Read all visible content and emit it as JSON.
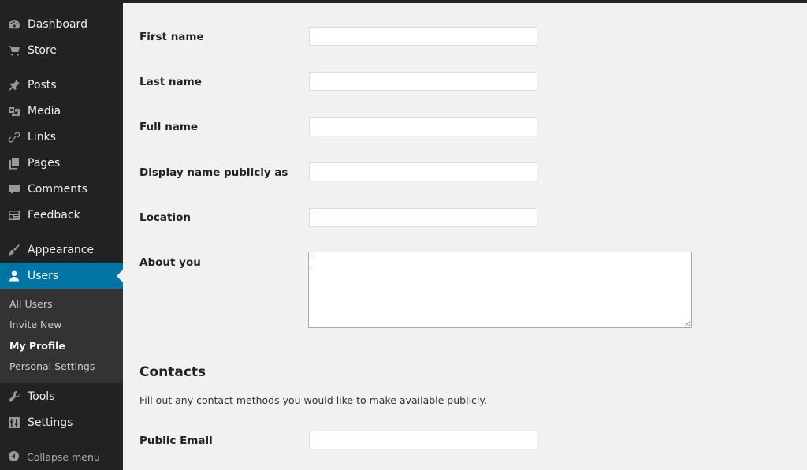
{
  "sidebar": {
    "items": [
      {
        "label": "Dashboard",
        "icon": "dashboard-icon"
      },
      {
        "label": "Store",
        "icon": "cart-icon"
      },
      {
        "label": "Posts",
        "icon": "pin-icon"
      },
      {
        "label": "Media",
        "icon": "media-icon"
      },
      {
        "label": "Links",
        "icon": "link-icon"
      },
      {
        "label": "Pages",
        "icon": "pages-icon"
      },
      {
        "label": "Comments",
        "icon": "comment-icon"
      },
      {
        "label": "Feedback",
        "icon": "feedback-icon"
      },
      {
        "label": "Appearance",
        "icon": "brush-icon"
      },
      {
        "label": "Users",
        "icon": "user-icon"
      },
      {
        "label": "Tools",
        "icon": "wrench-icon"
      },
      {
        "label": "Settings",
        "icon": "settings-icon"
      }
    ],
    "submenu": [
      "All Users",
      "Invite New",
      "My Profile",
      "Personal Settings"
    ],
    "collapse_label": "Collapse menu"
  },
  "form": {
    "first_name": {
      "label": "First name",
      "value": ""
    },
    "last_name": {
      "label": "Last name",
      "value": ""
    },
    "full_name": {
      "label": "Full name",
      "value": ""
    },
    "display_name": {
      "label": "Display name publicly as",
      "value": ""
    },
    "location": {
      "label": "Location",
      "value": ""
    },
    "about": {
      "label": "About you",
      "value": ""
    }
  },
  "contacts": {
    "title": "Contacts",
    "description": "Fill out any contact methods you would like to make available publicly.",
    "public_email": {
      "label": "Public Email",
      "value": ""
    }
  },
  "colors": {
    "sidebar_bg": "#222222",
    "active_bg": "#0074a2",
    "submenu_bg": "#333333",
    "page_bg": "#f1f1f1"
  }
}
